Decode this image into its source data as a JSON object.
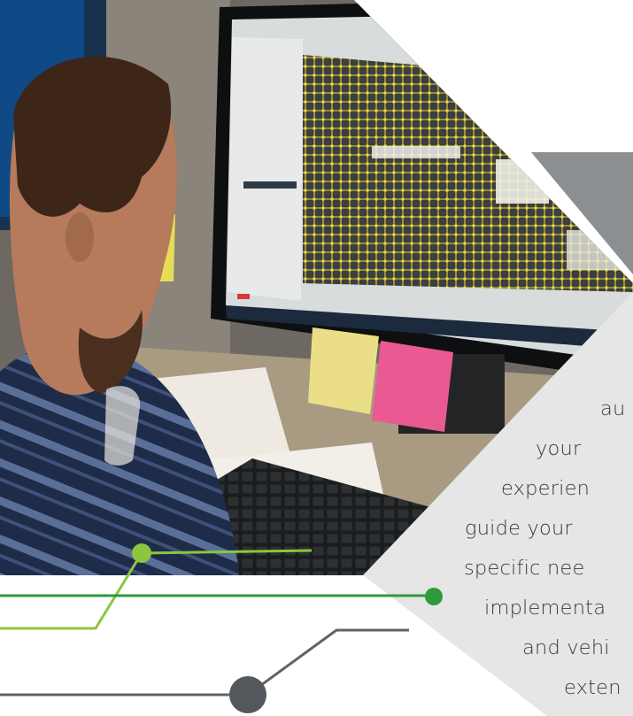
{
  "panel_text_lines": [
    "au",
    "your",
    "experien",
    "guide your",
    "specific nee",
    "implementa",
    "and vehi",
    "exten"
  ],
  "colors": {
    "panel_grey": "#e6e6e6",
    "dark_grey_panel": "#8b8f92",
    "green_dark": "#2e9a3a",
    "green_light": "#8cc63f",
    "grey_line": "#5f6468",
    "grey_dot": "#54585c"
  }
}
